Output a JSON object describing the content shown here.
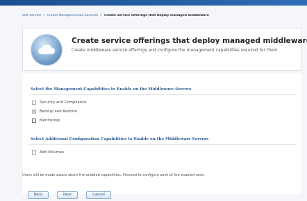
{
  "breadcrumb": {
    "items": [
      "Self Service",
      "Create Managed Cloud Services"
    ],
    "current": "Create service offerings that deploy managed middleware"
  },
  "header": {
    "title": "Create service offerings that deploy managed middleware",
    "subtitle": "Create middleware service offerings and configure the management capabilities required for them."
  },
  "management": {
    "heading": "Select the Management Capabilities to Enable on the Middleware Servers",
    "options": [
      "Security and Compliance",
      "Backup and Restore",
      "Monitoring"
    ]
  },
  "additional": {
    "heading": "Select Additional Configuration Capabilities to Enable on the Middleware Servers",
    "options": [
      "Add Volumes"
    ]
  },
  "note": "Users will be made aware about the enabled capabilities. Proceed to configure each of the enabled ones.",
  "buttons": {
    "back": "Back",
    "next": "Next",
    "cancel": "Cancel"
  },
  "colors": {
    "accent": "#2a5a96",
    "topbar": "#1a4f8f"
  }
}
